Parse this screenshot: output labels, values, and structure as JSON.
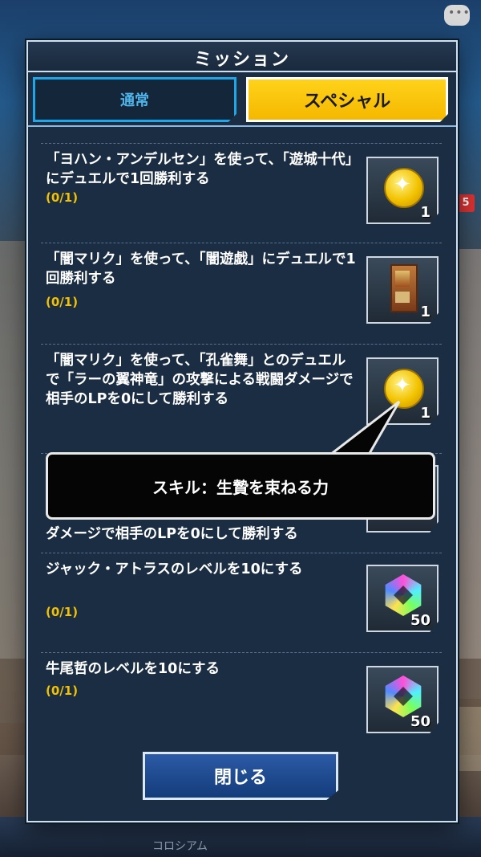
{
  "dialog": {
    "title": "ミッション",
    "tabs": [
      {
        "label": "通常",
        "active": false
      },
      {
        "label": "スペシャル",
        "active": true
      }
    ],
    "close_label": "閉じる"
  },
  "missions": [
    {
      "title": "「ヨハン・アンデルセン」を使って、「遊城十代」にデュエルで1回勝利する",
      "progress": "(0/1)",
      "reward_icon": "gold-coin-icon",
      "reward_count": "1"
    },
    {
      "title": "「闇マリク」を使って、「闇遊戯」にデュエルで1回勝利する",
      "progress": "(0/1)",
      "reward_icon": "card-icon",
      "reward_count": "1"
    },
    {
      "title": "「闇マリク」を使って、「孔雀舞」とのデュエルで「ラーの翼神竜」の攻撃による戦闘ダメージで相手のLPを0にして勝利する",
      "progress": "",
      "reward_icon": "gold-coin-icon",
      "reward_count": "1"
    },
    {
      "title": "ダメージで相手のLPを0にして勝利する",
      "progress": "",
      "reward_icon": "gem-icon",
      "reward_count": ""
    },
    {
      "title": "ジャック・アトラスのレベルを10にする",
      "progress": "(0/1)",
      "reward_icon": "gem-icon",
      "reward_count": "50"
    },
    {
      "title": "牛尾哲のレベルを10にする",
      "progress": "(0/1)",
      "reward_icon": "gem-icon",
      "reward_count": "50"
    }
  ],
  "tooltip": {
    "text": "スキル：生贄を束ねる力"
  },
  "background": {
    "nav_label": "コロシアム",
    "badge": "5"
  },
  "colors": {
    "accent_yellow": "#f5b800",
    "panel": "#1b2d42",
    "progress": "#f2c100",
    "tab_blue": "#1ea6e8"
  }
}
